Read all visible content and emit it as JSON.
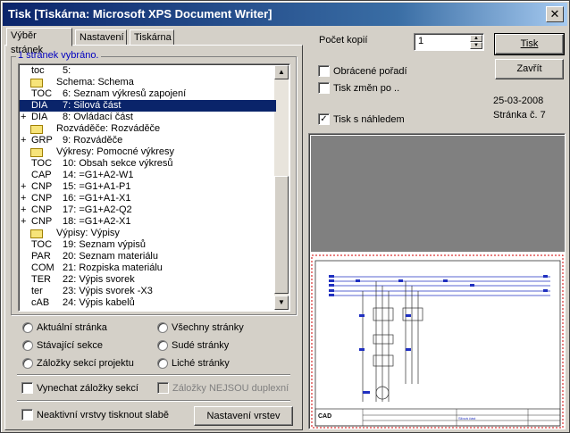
{
  "window": {
    "title": "Tisk [Tiskárna: Microsoft XPS Document Writer]",
    "close_glyph": "✕"
  },
  "tabs": [
    {
      "label": "Výběr stránek"
    },
    {
      "label": "Nastavení"
    },
    {
      "label": "Tiskárna"
    }
  ],
  "group": {
    "title": "1 stránek vybráno."
  },
  "pages": [
    {
      "prefix": "",
      "code": "toc",
      "desc": "5:",
      "folder": false,
      "selected": false
    },
    {
      "prefix": "",
      "code": "",
      "desc": "Schema: Schema",
      "folder": true,
      "selected": false
    },
    {
      "prefix": "",
      "code": "TOC",
      "desc": "6: Seznam výkresů zapojení",
      "folder": false,
      "selected": false
    },
    {
      "prefix": "",
      "code": "DIA",
      "desc": "7: Silová část",
      "folder": false,
      "selected": true
    },
    {
      "prefix": "+",
      "code": "DIA",
      "desc": "8: Ovládací část",
      "folder": false,
      "selected": false
    },
    {
      "prefix": "",
      "code": "",
      "desc": "Rozváděče: Rozváděče",
      "folder": true,
      "selected": false
    },
    {
      "prefix": "+",
      "code": "GRP",
      "desc": "9: Rozváděče",
      "folder": false,
      "selected": false
    },
    {
      "prefix": "",
      "code": "",
      "desc": "Výkresy: Pomocné výkresy",
      "folder": true,
      "selected": false
    },
    {
      "prefix": "",
      "code": "TOC",
      "desc": "10: Obsah sekce výkresů",
      "folder": false,
      "selected": false
    },
    {
      "prefix": "",
      "code": "CAP",
      "desc": "14: =G1+A2-W1",
      "folder": false,
      "selected": false
    },
    {
      "prefix": "+",
      "code": "CNP",
      "desc": "15: =G1+A1-P1",
      "folder": false,
      "selected": false
    },
    {
      "prefix": "+",
      "code": "CNP",
      "desc": "16: =G1+A1-X1",
      "folder": false,
      "selected": false
    },
    {
      "prefix": "+",
      "code": "CNP",
      "desc": "17: =G1+A2-Q2",
      "folder": false,
      "selected": false
    },
    {
      "prefix": "+",
      "code": "CNP",
      "desc": "18: =G1+A2-X1",
      "folder": false,
      "selected": false
    },
    {
      "prefix": "",
      "code": "",
      "desc": "Výpisy: Výpisy",
      "folder": true,
      "selected": false
    },
    {
      "prefix": "",
      "code": "TOC",
      "desc": "19: Seznam výpisů",
      "folder": false,
      "selected": false
    },
    {
      "prefix": "",
      "code": "PAR",
      "desc": "20: Seznam materiálu",
      "folder": false,
      "selected": false
    },
    {
      "prefix": "",
      "code": "COM",
      "desc": "21: Rozpiska materiálu",
      "folder": false,
      "selected": false
    },
    {
      "prefix": "",
      "code": "TER",
      "desc": "22: Výpis svorek",
      "folder": false,
      "selected": false
    },
    {
      "prefix": "",
      "code": "ter",
      "desc": "23: Výpis svorek -X3",
      "folder": false,
      "selected": false
    },
    {
      "prefix": "",
      "code": "cAB",
      "desc": "24: Výpis kabelů",
      "folder": false,
      "selected": false
    }
  ],
  "radios_left": [
    "Aktuální stránka",
    "Stávající sekce",
    "Záložky sekcí projektu"
  ],
  "radios_right": [
    "Všechny stránky",
    "Sudé stránky",
    "Liché stránky"
  ],
  "checks": {
    "skip_bookmarks": "Vynechat záložky sekcí",
    "not_duplex": "Záložky NEJSOU duplexní",
    "inactive_layers": "Neaktivní vrstvy tisknout slabě"
  },
  "buttons": {
    "layers": "Nastavení vrstev",
    "print": "Tisk",
    "close": "Zavřít"
  },
  "copies": {
    "label": "Počet kopií",
    "value": "1"
  },
  "options": {
    "reverse": "Obrácené pořadí",
    "print_changes": "Tisk změn po ..",
    "preview": "Tisk s náhledem"
  },
  "info": {
    "date": "25-03-2008",
    "page": "Stránka č. 7"
  },
  "preview_thumb": {
    "logo": "CAD",
    "title_cell": "Silová část"
  },
  "colors": {
    "title_bar": "#0a246a",
    "selection": "#0a246a",
    "group_title": "#0000c0",
    "preview_gray": "#808080",
    "border_red": "#d00000",
    "wire_blue": "#2030c0"
  }
}
